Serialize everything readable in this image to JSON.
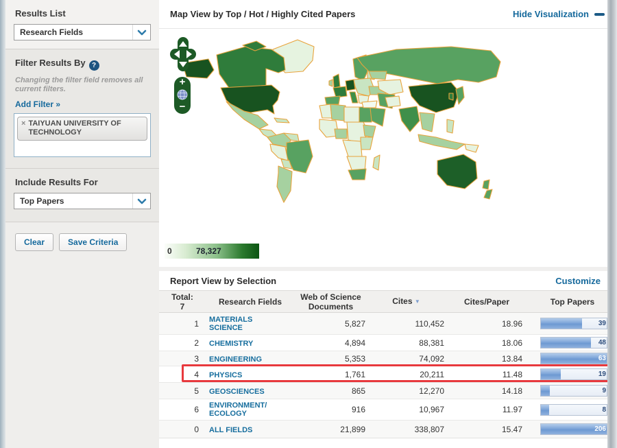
{
  "colors": {
    "link_blue": "#15699c",
    "sorted_header_blue": "#7d9ed0",
    "highlight_red": "#e8393d",
    "bar_fill_blue": "#7ba3d8",
    "legend_min_color": "#fbfdfa",
    "legend_max_color": "#0b5412",
    "map_border_orange": "#e8a33c"
  },
  "sidebar": {
    "results_list_heading": "Results List",
    "results_list_value": "Research Fields",
    "filter_heading": "Filter Results By",
    "filter_help": "?",
    "filter_note": "Changing the filter field removes all current filters.",
    "add_filter_link": "Add Filter »",
    "filter_tag": {
      "remove": "×",
      "label": "TAIYUAN UNIVERSITY OF TECHNOLOGY"
    },
    "include_heading": "Include Results For",
    "include_value": "Top Papers",
    "clear_button": "Clear",
    "save_button": "Save Criteria"
  },
  "map_view": {
    "title": "Map View by Top / Hot / Highly Cited Papers",
    "hide_link": "Hide Visualization",
    "zoom_in": "+",
    "zoom_out": "−",
    "legend_min": "0",
    "legend_max": "78,327"
  },
  "report": {
    "title": "Report View by Selection",
    "customize_link": "Customize",
    "header": {
      "total_label": "Total:",
      "total_value": "7",
      "fields": "Research Fields",
      "docs_line1": "Web of Science",
      "docs_line2": "Documents",
      "cites": "Cites",
      "sort_icon": "▼",
      "cites_per_paper": "Cites/Paper",
      "top_papers": "Top Papers"
    },
    "rows": [
      {
        "rank": "1",
        "field": "MATERIALS SCIENCE",
        "docs": "5,827",
        "cites": "110,452",
        "cpp": "18.96",
        "bar_label": "39",
        "bar_percent": 62,
        "highlighted": false
      },
      {
        "rank": "2",
        "field": "CHEMISTRY",
        "docs": "4,894",
        "cites": "88,381",
        "cpp": "18.06",
        "bar_label": "48",
        "bar_percent": 76,
        "highlighted": false
      },
      {
        "rank": "3",
        "field": "ENGINEERING",
        "docs": "5,353",
        "cites": "74,092",
        "cpp": "13.84",
        "bar_label": "63",
        "bar_percent": 100,
        "highlighted": false
      },
      {
        "rank": "4",
        "field": "PHYSICS",
        "docs": "1,761",
        "cites": "20,211",
        "cpp": "11.48",
        "bar_label": "19",
        "bar_percent": 30,
        "highlighted": true
      },
      {
        "rank": "5",
        "field": "GEOSCIENCES",
        "docs": "865",
        "cites": "12,270",
        "cpp": "14.18",
        "bar_label": "9",
        "bar_percent": 14,
        "highlighted": false
      },
      {
        "rank": "6",
        "field": "ENVIRONMENT/ECOLOGY",
        "docs": "916",
        "cites": "10,967",
        "cpp": "11.97",
        "bar_label": "8",
        "bar_percent": 13,
        "highlighted": false
      },
      {
        "rank": "0",
        "field": "ALL FIELDS",
        "docs": "21,899",
        "cites": "338,807",
        "cpp": "15.47",
        "bar_label": "206",
        "bar_percent": 100,
        "highlighted": false
      }
    ]
  }
}
